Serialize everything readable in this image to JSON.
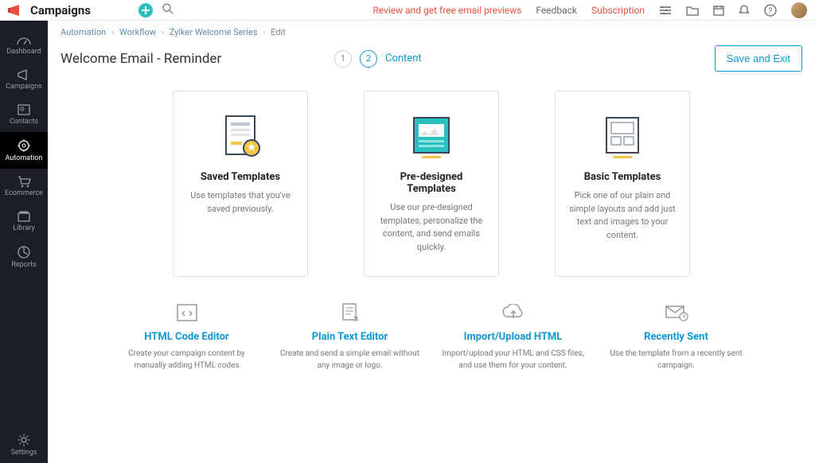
{
  "topbar": {
    "brand": "Campaigns",
    "review_link": "Review and get free email previews",
    "feedback": "Feedback",
    "subscription": "Subscription"
  },
  "sidebar": {
    "items": [
      {
        "label": "Dashboard"
      },
      {
        "label": "Campaigns"
      },
      {
        "label": "Contacts"
      },
      {
        "label": "Automation"
      },
      {
        "label": "Ecommerce"
      },
      {
        "label": "Library"
      },
      {
        "label": "Reports"
      }
    ],
    "settings": "Settings"
  },
  "breadcrumb": {
    "items": [
      "Automation",
      "Workflow",
      "Zylker Welcome Series"
    ],
    "current": "Edit"
  },
  "page": {
    "title": "Welcome Email - Reminder",
    "step2_label": "Content",
    "save_exit": "Save and Exit"
  },
  "steps": {
    "one": "1",
    "two": "2"
  },
  "cards": [
    {
      "title": "Saved Templates",
      "desc": "Use templates that you've saved previously."
    },
    {
      "title": "Pre-designed Templates",
      "desc": "Use our pre-designed templates, personalize the content, and send emails quickly."
    },
    {
      "title": "Basic Templates",
      "desc": "Pick one of our plain and simple layouts and add just text and images to your content."
    }
  ],
  "options": [
    {
      "title": "HTML Code Editor",
      "desc": "Create your campaign content by manually adding HTML codes"
    },
    {
      "title": "Plain Text Editor",
      "desc": "Create and send a simple email without any image or logo."
    },
    {
      "title": "Import/Upload HTML",
      "desc": "Import/upload your HTML and CSS files, and use them for your content."
    },
    {
      "title": "Recently Sent",
      "desc": "Use the template from a recently sent campaign."
    }
  ]
}
